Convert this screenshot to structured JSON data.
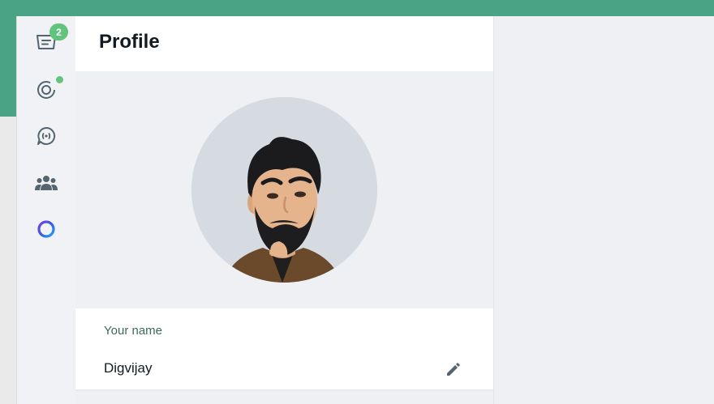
{
  "colors": {
    "accent": "#4aa384",
    "badge": "#62c37c",
    "icon": "#54656f",
    "title": "#111b21",
    "label": "#3b6b5d",
    "panel_bg": "#eef0f4"
  },
  "rail": {
    "items": [
      {
        "name": "chats",
        "icon": "chat-list-icon",
        "badge": "2"
      },
      {
        "name": "status",
        "icon": "status-icon",
        "has_dot": true
      },
      {
        "name": "channels",
        "icon": "channels-icon"
      },
      {
        "name": "communities",
        "icon": "communities-icon"
      },
      {
        "name": "meta-ai",
        "icon": "meta-ai-icon"
      }
    ]
  },
  "profile": {
    "title": "Profile",
    "name_label": "Your name",
    "name_value": "Digvijay"
  }
}
